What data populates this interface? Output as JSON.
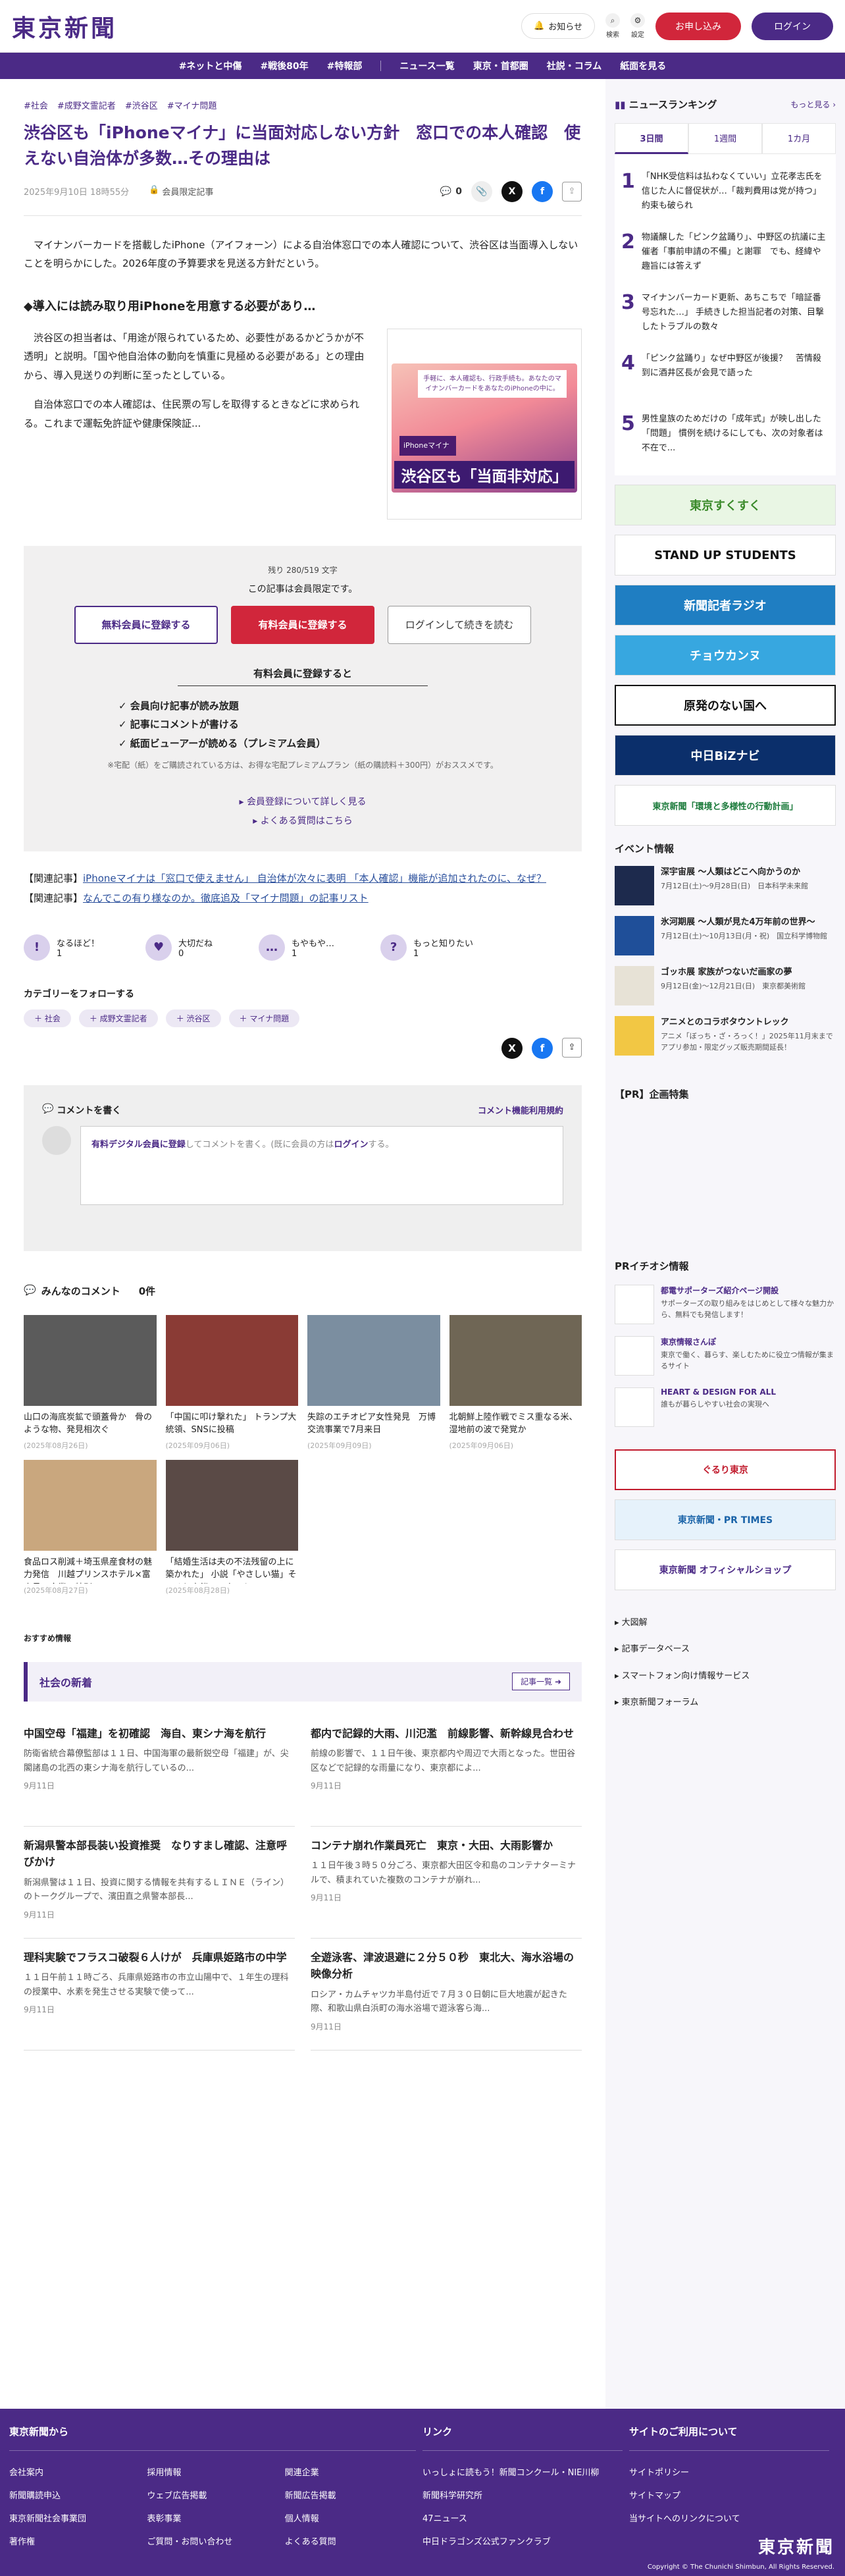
{
  "header": {
    "logo": "東京新聞",
    "notice": "お知らせ",
    "search": "検索",
    "settings": "設定",
    "apply": "お申し込み",
    "login": "ログイン"
  },
  "nav": [
    "#ネットと中傷",
    "#戦後80年",
    "#特報部",
    "ニュース一覧",
    "東京・首都圏",
    "社説・コラム",
    "紙面を見る"
  ],
  "article": {
    "tags": [
      "#社会",
      "#成野文霊記者",
      "#渋谷区",
      "#マイナ問題"
    ],
    "title": "渋谷区も「iPhoneマイナ」に当面対応しない方針　窓口での本人確認　使えない自治体が多数…その理由は",
    "date": "2025年9月10日 18時55分",
    "member_only": "会員限定記事",
    "comment_count": "0",
    "lede": "マイナンバーカードを搭載したiPhone（アイフォーン）による自治体窓口での本人確認について、渋谷区は当面導入しないことを明らかにした。2026年度の予算要求を見送る方針だという。",
    "subhead": "◆導入には読み取り用iPhoneを用意する必要があり…",
    "p1": "渋谷区の担当者は、「用途が限られているため、必要性があるかどうかが不透明」と説明。「国や他自治体の動向を慎重に見極める必要がある」との理由から、導入見送りの判断に至ったとしている。",
    "p2": "自治体窓口での本人確認は、住民票の写しを取得するときなどに求められる。これまで運転免許証や健康保険証...",
    "figure": {
      "card_text": "手軽に、本人確認も、行政手続も。あなたのマイナンバーカードをあなたのiPhoneの中に。",
      "phone_label": "iPhoneマイナ",
      "caption": "渋谷区も「当面非対応」"
    }
  },
  "paywall": {
    "remain": "残り 280/519 文字",
    "note": "この記事は会員限定です。",
    "free_btn": "無料会員に登録する",
    "paid_btn": "有料会員に登録する",
    "login_btn": "ログインして続きを読む",
    "benefit_title": "有料会員に登録すると",
    "benefits": [
      "会員向け記事が読み放題",
      "記事にコメントが書ける",
      "紙面ビューアーが読める（プレミアム会員）"
    ],
    "benefit_note": "※宅配（紙）をご購読されている方は、お得な宅配プレミアムプラン（紙の購読料＋300円）がおススメです。",
    "link1": "会員登録について詳しく見る",
    "link2": "よくある質問はこちら"
  },
  "related": [
    {
      "label": "【関連記事】",
      "text": "iPhoneマイナは「窓口で使えません」 自治体が次々に表明 「本人確認」機能が追加されたのに、なぜ？"
    },
    {
      "label": "【関連記事】",
      "text": "なんでこの有り様なのか。徹底追及「マイナ問題」の記事リスト"
    }
  ],
  "reactions": [
    {
      "label": "なるほど！",
      "count": "1",
      "icon": "!"
    },
    {
      "label": "大切だね",
      "count": "0",
      "icon": "♥"
    },
    {
      "label": "もやもや…",
      "count": "1",
      "icon": "…"
    },
    {
      "label": "もっと知りたい",
      "count": "1",
      "icon": "?"
    }
  ],
  "category": {
    "title": "カテゴリーをフォローする",
    "tags": [
      "社会",
      "成野文霊記者",
      "渋谷区",
      "マイナ問題"
    ]
  },
  "comment": {
    "head": "コメントを書く",
    "rules": "コメント機能利用規約",
    "prompt_bold": "有料デジタル会員に登録",
    "prompt": "してコメントを書く。(既に会員の方は",
    "prompt_login": "ログイン",
    "prompt_end": "する。",
    "all": "みんなのコメント",
    "all_count": "0件"
  },
  "thumbs": [
    {
      "cap": "山口の海底炭鉱で頭蓋骨か　骨のような物、発見相次ぐ",
      "dt": "(2025年08月26日)",
      "color": "#5b5b5b"
    },
    {
      "cap": "「中国に叩け撃れた」 トランプ大統領、SNSに投稿",
      "dt": "(2025年09月06日)",
      "color": "#8a3b35"
    },
    {
      "cap": "失踪のエチオピア女性発見　万博交流事業で7月来日",
      "dt": "(2025年09月09日)",
      "color": "#7b8ea0"
    },
    {
      "cap": "北朝鮮上陸作戦でミス重なる米、湿地前の波で発覚か",
      "dt": "(2025年09月06日)",
      "color": "#6f6655"
    },
    {
      "cap": "食品ロス削減＋埼玉県産食材の魅力発信　川越プリンスホテル×富士見の企業、特別メニュー...",
      "dt": "(2025年08月27日)",
      "color": "#c9a77e"
    },
    {
      "cap": "「結婚生活は夫の不法残留の上に築かれた」 小説「やさしい猫」そっくり実態、二審でも...",
      "dt": "(2025年08月28日)",
      "color": "#5a4a46"
    }
  ],
  "recommend": "おすすめ情報",
  "news": {
    "head": "社会の新着",
    "all": "記事一覧",
    "items": [
      {
        "t": "中国空母「福建」を初確認　海自、東シナ海を航行",
        "d": "防衛省統合幕僚監部は１１日、中国海軍の最新鋭空母「福建」が、尖閣諸島の北西の東シナ海を航行しているの...",
        "dt": "9月11日"
      },
      {
        "t": "都内で記録的大雨、川氾濫　前線影響、新幹線見合わせ",
        "d": "前線の影響で、１１日午後、東京都内や周辺で大雨となった。世田谷区などで記録的な雨量になり、東京都によ...",
        "dt": "9月11日"
      },
      {
        "t": "新潟県警本部長装い投資推奨　なりすまし確認、注意呼びかけ",
        "d": "新潟県警は１１日、投資に関する情報を共有するＬＩＮＥ（ライン）のトークグループで、濱田直之県警本部長...",
        "dt": "9月11日"
      },
      {
        "t": "コンテナ崩れ作業員死亡　東京・大田、大雨影響か",
        "d": "１１日午後３時５０分ごろ、東京都大田区令和島のコンテナターミナルで、積まれていた複数のコンテナが崩れ...",
        "dt": "9月11日"
      },
      {
        "t": "理科実験でフラスコ破裂６人けが　兵庫県姫路市の中学",
        "d": "１１日午前１１時ごろ、兵庫県姫路市の市立山陽中で、１年生の理科の授業中、水素を発生させる実験で使って...",
        "dt": "9月11日"
      },
      {
        "t": "全遊泳客、津波退避に２分５０秒　東北大、海水浴場の映像分析",
        "d": "ロシア・カムチャツカ半島付近で７月３０日朝に巨大地震が起きた際、和歌山県白浜町の海水浴場で遊泳客ら海...",
        "dt": "9月11日"
      }
    ]
  },
  "ranking": {
    "head": "ニュースランキング",
    "more": "もっと見る",
    "tabs": [
      "3日間",
      "1週間",
      "1カ月"
    ],
    "items": [
      {
        "n": "1",
        "t": "「NHK受信料は払わなくていい」立花孝志氏を信じた人に督促状が…「裁判費用は党が持つ」約束も破られ"
      },
      {
        "n": "2",
        "t": "物議醸した「ピンク盆踊り」、中野区の抗議に主催者「事前申請の不備」と謝罪　でも、経緯や趣旨には答えず"
      },
      {
        "n": "3",
        "t": "マイナンバーカード更新、あちこちで「暗証番号忘れた…」 手続きした担当記者の対策、目撃したトラブルの数々"
      },
      {
        "n": "4",
        "t": "「ピンク盆踊り」なぜ中野区が後援？　苦情殺到に酒井区長が会見で語った"
      },
      {
        "n": "5",
        "t": "男性皇族のためだけの「成年式」が映し出した「問題」 慣例を続けるにしても、次の対象者は不在で..."
      }
    ]
  },
  "side_banners": [
    "東京すくすく",
    "STAND UP STUDENTS",
    "新聞記者ラジオ",
    "チョウカンヌ",
    "原発のない国へ",
    "中日BiZナビ",
    "東京新聞「環境と多様性の行動計画」"
  ],
  "events": {
    "title": "イベント情報",
    "items": [
      {
        "t": "深宇宙展 ～人類はどこへ向かうのか",
        "d": "7月12日(土)～9月28日(日)　日本科学未来館",
        "color": "#1d2a4d"
      },
      {
        "t": "氷河期展 ～人類が見た4万年前の世界～",
        "d": "7月12日(土)～10月13日(月・祝)　国立科学博物館",
        "color": "#1f4f99"
      },
      {
        "t": "ゴッホ展 家族がつないだ画家の夢",
        "d": "9月12日(金)～12月21日(日)　東京都美術館",
        "color": "#e7e2d6"
      },
      {
        "t": "アニメとのコラボタウントレック",
        "d": "アニメ「ぼっち・ざ・ろっく！」2025年11月末までアプリ参加・限定グッズ販売期間延長！",
        "color": "#f2c744"
      }
    ]
  },
  "pr_title": "【PR】企画特集",
  "pr2_title": "PRイチオシ情報",
  "prinfo": [
    {
      "t": "都電サポーターズ紹介ページ開設",
      "d": "サポーターズの取り組みをはじめとして様々な魅力から、無料でも発信します！"
    },
    {
      "t": "東京情報さんぽ",
      "d": "東京で働く、暮らす、楽しむために役立つ情報が集まるサイト"
    },
    {
      "t": "HEART & DESIGN FOR ALL",
      "d": "誰もが暮らしやすい社会の実現へ"
    }
  ],
  "side_banners2": [
    "ぐるり東京",
    "東京新聞・PR TIMES",
    "東京新聞 オフィシャルショップ"
  ],
  "side_links": [
    "大図解",
    "記事データベース",
    "スマートフォン向け情報サービス",
    "東京新聞フォーラム"
  ],
  "footer": {
    "col1": "東京新聞から",
    "col1_items": [
      "会社案内",
      "採用情報",
      "関連企業",
      "新聞購読申込",
      "ウェブ広告掲載",
      "新聞広告掲載",
      "東京新聞社会事業団",
      "表彰事業",
      "個人情報",
      "著作権",
      "ご質問・お問い合わせ",
      "よくある質問"
    ],
    "col2": "リンク",
    "col2_items": [
      "いっしょに読もう！新聞コンクール・NIE川柳",
      "新聞科学研究所",
      "47ニュース",
      "中日ドラゴンズ公式ファンクラブ"
    ],
    "col3": "サイトのご利用について",
    "col3_items": [
      "サイトポリシー",
      "サイトマップ",
      "当サイトへのリンクについて"
    ],
    "logo": "東京新聞",
    "copy": "Copyright © The Chunichi Shimbun, All Rights Reserved."
  }
}
